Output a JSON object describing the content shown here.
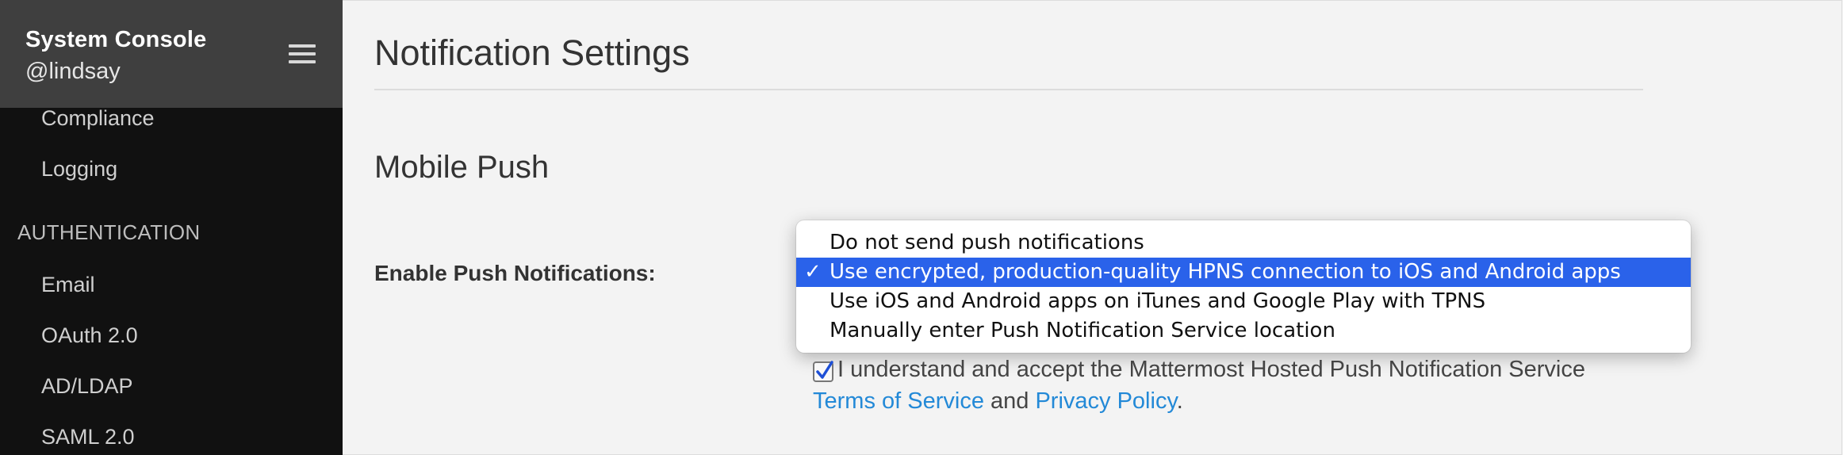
{
  "sidebar": {
    "title": "System Console",
    "user": "@lindsay",
    "items_top": [
      "Compliance",
      "Logging"
    ],
    "section": "AUTHENTICATION",
    "items_auth": [
      "Email",
      "OAuth 2.0",
      "AD/LDAP",
      "SAML 2.0"
    ]
  },
  "main": {
    "page_title": "Notification Settings",
    "section_title": "Mobile Push",
    "field_label": "Enable Push Notifications:",
    "dropdown": {
      "options": [
        "Do not send push notifications",
        "Use encrypted, production-quality HPNS connection to iOS and Android apps",
        "Use iOS and Android apps on iTunes and Google Play with TPNS",
        "Manually enter Push Notification Service location"
      ],
      "selected_index": 1,
      "check_mark": "✓"
    },
    "terms": {
      "checked": true,
      "text": "I understand and accept the Mattermost Hosted Push Notification Service",
      "link1": "Terms of Service",
      "and": " and ",
      "link2": "Privacy Policy",
      "period": "."
    }
  },
  "colors": {
    "sidebar_bg": "#111111",
    "sidebar_header_bg": "#3f3f3f",
    "selected_bg": "#2a62ea",
    "link": "#2389d7"
  }
}
